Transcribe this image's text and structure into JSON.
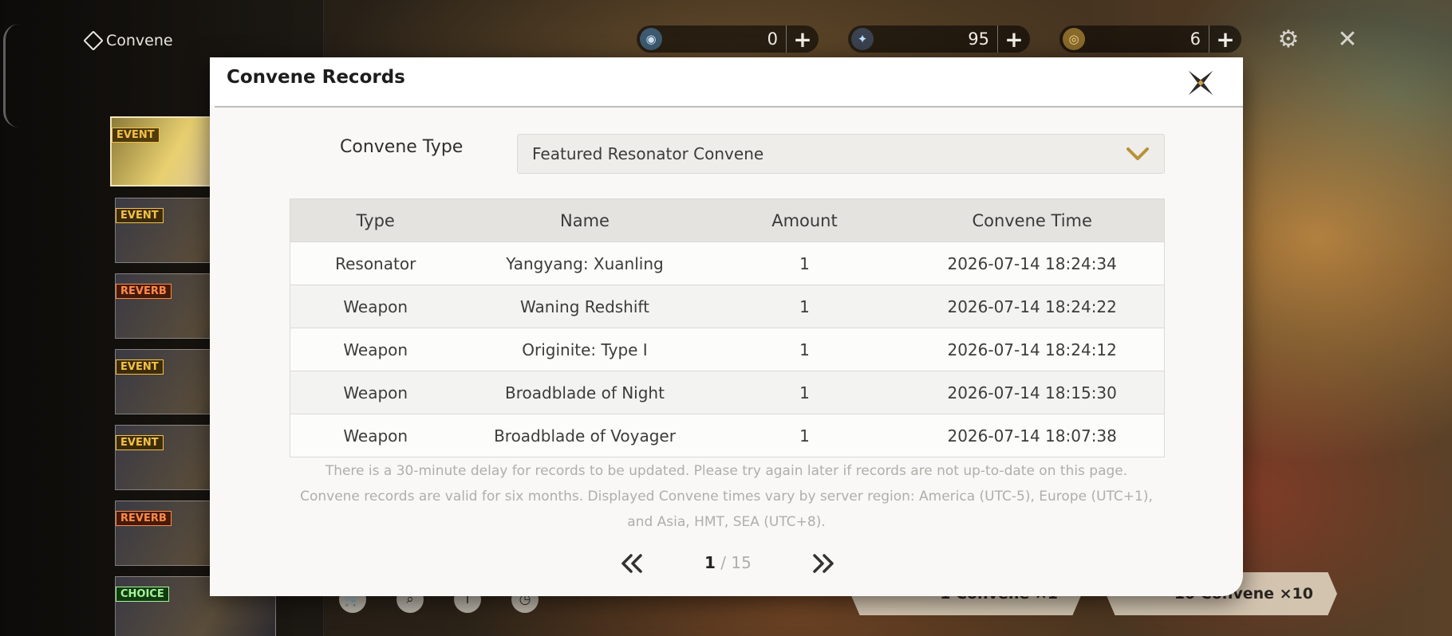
{
  "app": {
    "title": "Convene"
  },
  "left_banners": [
    {
      "tag": "EVENT",
      "kind": "event"
    },
    {
      "tag": "EVENT",
      "kind": "event"
    },
    {
      "tag": "REVERB",
      "kind": "reverb"
    },
    {
      "tag": "EVENT",
      "kind": "event"
    },
    {
      "tag": "EVENT",
      "kind": "event"
    },
    {
      "tag": "REVERB",
      "kind": "reverb"
    },
    {
      "tag": "CHOICE",
      "kind": "choice"
    }
  ],
  "currencies": [
    {
      "amount": "0",
      "icon": "lustrous-tide-icon"
    },
    {
      "amount": "95",
      "icon": "astrite-icon"
    },
    {
      "amount": "6",
      "icon": "radiant-tide-icon"
    }
  ],
  "bottom_actions": {
    "convene_x1": "1     Convene ×1",
    "convene_x10": "10     Convene ×10"
  },
  "dialog": {
    "title": "Convene Records",
    "convene_type_label": "Convene Type",
    "convene_type_value": "Featured Resonator Convene",
    "table": {
      "headers": [
        "Type",
        "Name",
        "Amount",
        "Convene Time"
      ],
      "rows": [
        {
          "type": "Resonator",
          "name": "Yangyang: Xuanling",
          "amount": "1",
          "time": "2026-07-14 18:24:34",
          "rarity_color": "#d6a81f"
        },
        {
          "type": "Weapon",
          "name": "Waning Redshift",
          "amount": "1",
          "time": "2026-07-14 18:24:22",
          "rarity_color": "#9a6fb1"
        },
        {
          "type": "Weapon",
          "name": "Originite: Type I",
          "amount": "1",
          "time": "2026-07-14 18:24:12",
          "rarity_color": "#3c3c3c"
        },
        {
          "type": "Weapon",
          "name": "Broadblade of Night",
          "amount": "1",
          "time": "2026-07-14 18:15:30",
          "rarity_color": "#3c3c3c"
        },
        {
          "type": "Weapon",
          "name": "Broadblade of Voyager",
          "amount": "1",
          "time": "2026-07-14 18:07:38",
          "rarity_color": "#3c3c3c"
        }
      ]
    },
    "notice_lines": [
      "There is a 30-minute delay for records to be updated. Please try again later if records are not up-to-date on this page.",
      "Convene records are valid for six months. Displayed Convene times vary by server region: America (UTC-5), Europe (UTC+1),",
      "and Asia, HMT, SEA (UTC+8)."
    ],
    "pagination": {
      "current": "1",
      "separator": " / ",
      "total": "15"
    }
  }
}
